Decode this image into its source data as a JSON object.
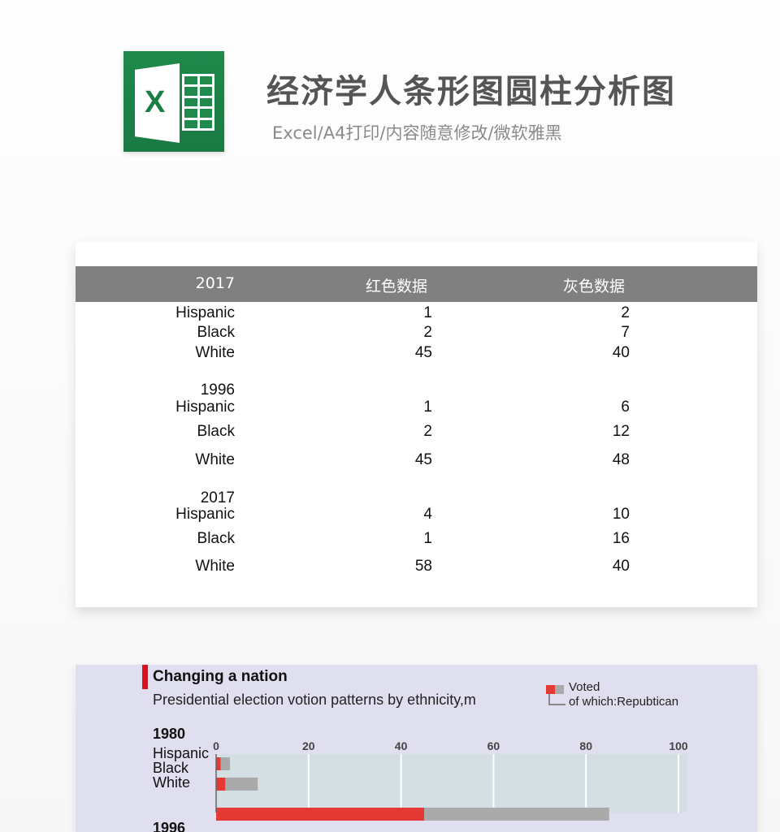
{
  "header": {
    "title": "经济学人条形图圆柱分析图",
    "subtitle": "Excel/A4打印/内容随意修改/微软雅黑",
    "logo_icon": "excel-icon",
    "logo_letter": "X"
  },
  "table": {
    "columns": [
      "2017",
      "红色数据",
      "灰色数据"
    ],
    "groups": [
      {
        "year": "",
        "rows": [
          {
            "label": "Hispanic",
            "red": "1",
            "gray": "2"
          },
          {
            "label": "Black",
            "red": "2",
            "gray": "7"
          },
          {
            "label": "White",
            "red": "45",
            "gray": "40"
          }
        ]
      },
      {
        "year": "1996",
        "rows": [
          {
            "label": "Hispanic",
            "red": "1",
            "gray": "6"
          },
          {
            "label": "Black",
            "red": "2",
            "gray": "12"
          },
          {
            "label": "White",
            "red": "45",
            "gray": "48"
          }
        ]
      },
      {
        "year": "2017",
        "rows": [
          {
            "label": "Hispanic",
            "red": "4",
            "gray": "10"
          },
          {
            "label": "Black",
            "red": "1",
            "gray": "16"
          },
          {
            "label": "White",
            "red": "58",
            "gray": "40"
          }
        ]
      }
    ]
  },
  "chart": {
    "title": "Changing a nation",
    "subtitle": "Presidential election votion patterns by ethnicity,m",
    "legend": {
      "voted": "Voted",
      "republican": "of which:Repubtican"
    },
    "colors": {
      "red": "#e53935",
      "gray": "#aaaaaa",
      "plot_bg": "#d3dfe3",
      "panel_bg": "#dfdfef",
      "accent": "#e0101a"
    },
    "groups_visible": [
      {
        "year": "1980",
        "labels": [
          "Hispanic",
          "Black",
          "White"
        ]
      },
      {
        "year": "1996",
        "labels": []
      }
    ]
  },
  "chart_data": {
    "type": "bar",
    "title": "Changing a nation",
    "subtitle": "Presidential election votion patterns by ethnicity,m",
    "orientation": "horizontal",
    "stacked": true,
    "xlim": [
      0,
      100
    ],
    "xticks": [
      "0",
      "20",
      "40",
      "60",
      "80",
      "100"
    ],
    "xtick_values": [
      0,
      20,
      40,
      60,
      80,
      100
    ],
    "grid": true,
    "legend_position": "top-right",
    "groups": [
      {
        "name": "1980",
        "categories": [
          "Hispanic",
          "Black",
          "White"
        ],
        "series": [
          {
            "name": "of which:Repubtican",
            "color": "#e53935",
            "values": [
              1,
              2,
              45
            ]
          },
          {
            "name": "Voted",
            "color": "#aaaaaa",
            "values": [
              2,
              7,
              40
            ]
          }
        ]
      }
    ]
  }
}
